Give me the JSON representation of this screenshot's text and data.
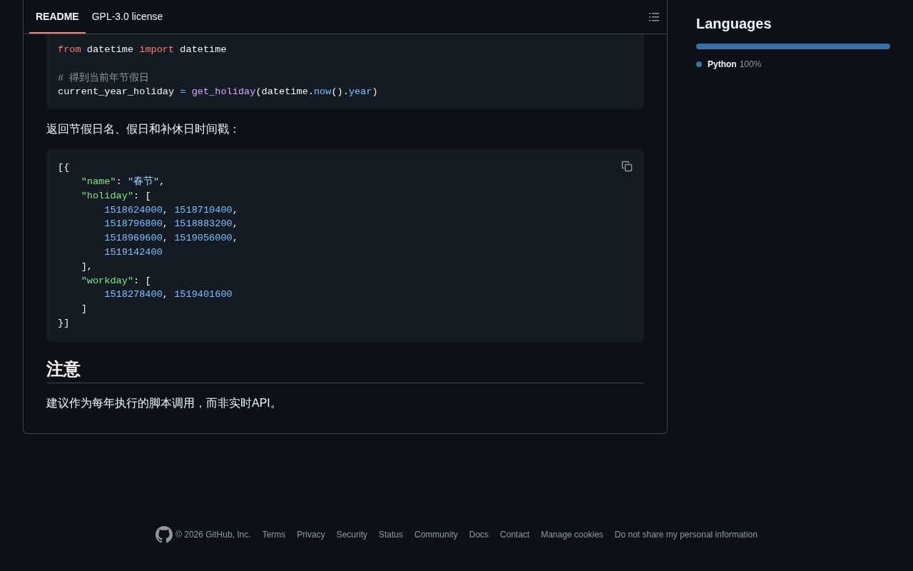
{
  "readme_tabs": [
    {
      "label": "README",
      "selected": true
    },
    {
      "label": "GPL-3.0 license",
      "selected": false
    }
  ],
  "content": [
    {
      "kind": "code",
      "lines": [
        {
          "tokens": [
            {
              "text": "from",
              "kind": "keyword"
            },
            {
              "text": " datetime ",
              "kind": "plain"
            },
            {
              "text": "import",
              "kind": "keyword"
            },
            {
              "text": " datetime",
              "kind": "plain"
            }
          ]
        },
        {
          "blank_before": true,
          "tokens": [
            {
              "text": "# 得到当前年节假日",
              "kind": "comment"
            }
          ]
        },
        {
          "tokens": [
            {
              "text": "current_year_holiday ",
              "kind": "plain"
            },
            {
              "text": "= ",
              "kind": "number"
            },
            {
              "text": "get_holiday",
              "kind": "func"
            },
            {
              "text": "(datetime.",
              "kind": "plain"
            },
            {
              "text": "now",
              "kind": "number"
            },
            {
              "text": "().",
              "kind": "plain"
            },
            {
              "text": "year",
              "kind": "number"
            },
            {
              "text": ")",
              "kind": "plain"
            }
          ]
        }
      ]
    },
    {
      "kind": "paragraph",
      "text": "返回节假日名、假日和补休日时间戳："
    },
    {
      "kind": "code",
      "copy_button": true,
      "lines": [
        {
          "tokens": [
            {
              "text": "[{",
              "kind": "plain"
            }
          ]
        },
        {
          "tokens": [
            {
              "text": "    \"name\"",
              "kind": "string"
            },
            {
              "text": ": ",
              "kind": "plain"
            },
            {
              "text": "\"春节\"",
              "kind": "value"
            },
            {
              "text": ",",
              "kind": "plain"
            }
          ]
        },
        {
          "tokens": [
            {
              "text": "    \"holiday\"",
              "kind": "string"
            },
            {
              "text": ": [",
              "kind": "plain"
            }
          ]
        },
        {
          "tokens": [
            {
              "text": "        1518624000",
              "kind": "number"
            },
            {
              "text": ", ",
              "kind": "plain"
            },
            {
              "text": "1518710400",
              "kind": "number"
            },
            {
              "text": ",",
              "kind": "plain"
            }
          ]
        },
        {
          "tokens": [
            {
              "text": "        1518796800",
              "kind": "number"
            },
            {
              "text": ", ",
              "kind": "plain"
            },
            {
              "text": "1518883200",
              "kind": "number"
            },
            {
              "text": ",",
              "kind": "plain"
            }
          ]
        },
        {
          "tokens": [
            {
              "text": "        1518969600",
              "kind": "number"
            },
            {
              "text": ", ",
              "kind": "plain"
            },
            {
              "text": "1519056000",
              "kind": "number"
            },
            {
              "text": ",",
              "kind": "plain"
            }
          ]
        },
        {
          "tokens": [
            {
              "text": "        1519142400",
              "kind": "number"
            }
          ]
        },
        {
          "tokens": [
            {
              "text": "    ],",
              "kind": "plain"
            }
          ]
        },
        {
          "tokens": [
            {
              "text": "    \"workday\"",
              "kind": "string"
            },
            {
              "text": ": [",
              "kind": "plain"
            }
          ]
        },
        {
          "tokens": [
            {
              "text": "        1518278400",
              "kind": "number"
            },
            {
              "text": ", ",
              "kind": "plain"
            },
            {
              "text": "1519401600",
              "kind": "number"
            }
          ]
        },
        {
          "tokens": [
            {
              "text": "    ]",
              "kind": "plain"
            }
          ]
        },
        {
          "tokens": [
            {
              "text": "}]",
              "kind": "plain"
            }
          ]
        }
      ]
    },
    {
      "kind": "heading",
      "text": "注意"
    },
    {
      "kind": "paragraph",
      "text": "建议作为每年执行的脚本调用，而非实时API。"
    }
  ],
  "languages": {
    "title": "Languages",
    "items": [
      {
        "name": "Python",
        "percent": "100%",
        "level": 1,
        "color": "#3572a5"
      }
    ]
  },
  "footer": {
    "copyright": "© 2026 GitHub, Inc.",
    "links": [
      "Terms",
      "Privacy",
      "Security",
      "Status",
      "Community",
      "Docs",
      "Contact",
      "Manage cookies",
      "Do not share my personal information"
    ]
  }
}
